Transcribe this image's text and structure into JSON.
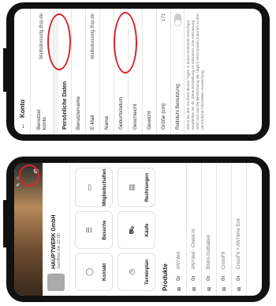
{
  "account": {
    "back_icon": "back-arrow-icon",
    "title": "Konto",
    "user_label": "Benutzer konto",
    "user_value": "Mailbdressetg.Bsp.de",
    "section_personal": "Persönliche Daten",
    "fields": [
      {
        "label": "Benutzername",
        "value": ""
      },
      {
        "label": "E-Mail",
        "value": "Mailbdressetg.Bsp.de"
      },
      {
        "label": "Name",
        "value": ""
      },
      {
        "label": "Geburtsdatum",
        "value": ""
      },
      {
        "label": "Geschlecht",
        "value": ""
      },
      {
        "label": "Gewicht",
        "value": ""
      },
      {
        "label": "Größe (cm)",
        "value": "171"
      }
    ],
    "wheelchair_label": "Rollstuhl Benutzung",
    "wheelchair_desc": "Wenn du den Großteil deines Tages in einem Rollstuhl verbringst, empfehlen wir dir, diese Einstellung zu aktivieren. Die Aktivierung wirkt sich auf die Berechnung der täglich verbrannten Kalorien in Ihre persönliche Aktivitäten-Auswertung."
  },
  "studio": {
    "settings_icon": "gear-icon",
    "name": "HAUPTWERK GmbH",
    "hours": "Geöffnet bis 22:00",
    "tiles": [
      {
        "label": "Kontakt",
        "icon": "chat-icon"
      },
      {
        "label": "Besuche",
        "icon": "list-icon"
      },
      {
        "label": "Mitgliedschaften",
        "icon": "card-icon"
      },
      {
        "label": "Terminplan",
        "icon": "clock-icon"
      },
      {
        "label": "Käufe",
        "icon": "cart-icon"
      },
      {
        "label": "Rechnungen",
        "icon": "receipt-icon"
      }
    ],
    "products_title": "Produkte",
    "products": [
      {
        "qty": "0x",
        "name": "ANYded"
      },
      {
        "qty": "0x",
        "name": "ANYded - Check-in"
      },
      {
        "qty": "0x",
        "name": "Bistro-Guthaben"
      },
      {
        "qty": "0x",
        "name": "CrossFit"
      },
      {
        "qty": "0x",
        "name": "CrossFit + ANYtime Erw"
      }
    ]
  }
}
